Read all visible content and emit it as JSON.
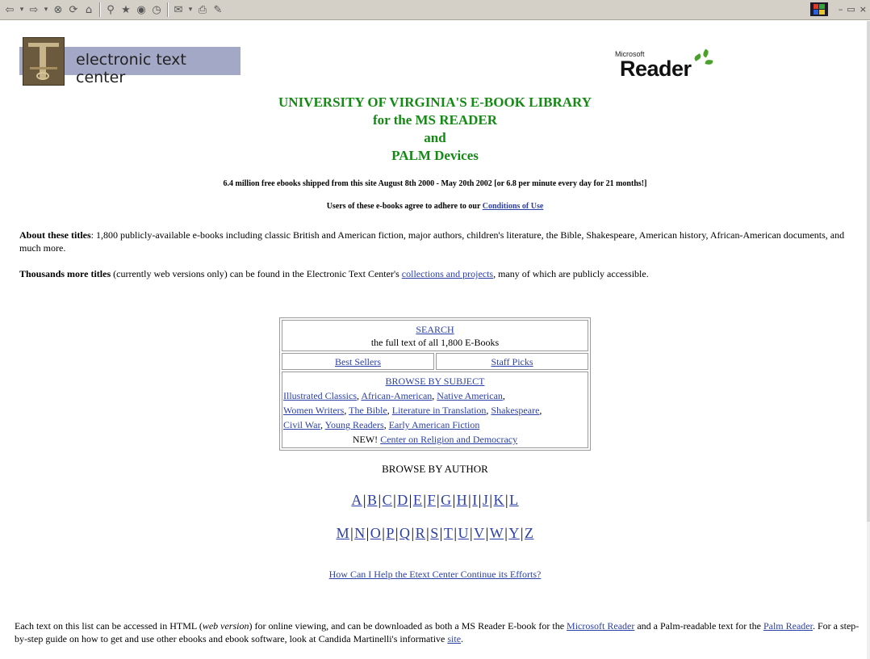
{
  "toolbar": {
    "icons": [
      "back-arrow-icon",
      "forward-arrow-icon",
      "stop-icon",
      "refresh-icon",
      "home-icon",
      "search-icon",
      "favorites-icon",
      "channels-icon",
      "history-icon",
      "mail-icon",
      "print-icon",
      "edit-icon"
    ],
    "window_controls": [
      "–",
      "Β",
      "×"
    ]
  },
  "header": {
    "etc_title": "electronic text center",
    "ms_small": "Microsoft",
    "ms_big": "Reader"
  },
  "titles": {
    "line1": "UNIVERSITY OF VIRGINIA'S E-BOOK LIBRARY",
    "line2": "for the MS READER",
    "line3": "and",
    "line4": "PALM Devices"
  },
  "stats": "6.4 million free ebooks shipped from this site August 8th 2000 - May 20th 2002 [or 6.8 per minute every day for 21 months!]",
  "terms": {
    "prefix": "Users of these e-books agree to adhere to our ",
    "link": "Conditions of Use"
  },
  "about": {
    "bold": "About these titles",
    "text": ": 1,800 publicly-available e-books including classic British and American fiction, major authors, children's literature, the Bible, Shakespeare, American history, African-American documents, and much more."
  },
  "more": {
    "bold": "Thousands more titles",
    "before": " (currently web versions only) can be found in the Electronic Text Center's ",
    "link": "collections and projects",
    "after": ", many of which are publicly accessible."
  },
  "box": {
    "search_link": "SEARCH",
    "search_sub": "the full text of all 1,800 E-Books",
    "best_sellers": "Best Sellers",
    "staff_picks": "Staff Picks",
    "browse_subject": "BROWSE BY SUBJECT",
    "subjects_line1": [
      "Illustrated Classics",
      "African-American",
      "Native American"
    ],
    "subjects_line2": [
      "Women Writers",
      "The Bible",
      "Literature in Translation",
      "Shakespeare"
    ],
    "subjects_line3": [
      "Civil War",
      "Young Readers",
      "Early American Fiction"
    ],
    "new_label": "NEW! ",
    "new_link": "Center on Religion and Democracy"
  },
  "authors": {
    "heading": "BROWSE BY AUTHOR",
    "row1": [
      "A",
      "B",
      "C",
      "D",
      "E",
      "F",
      "G",
      "H",
      "I",
      "J",
      "K",
      "L"
    ],
    "row2": [
      "M",
      "N",
      "O",
      "P",
      "Q",
      "R",
      "S",
      "T",
      "U",
      "V",
      "W",
      "Y",
      "Z"
    ]
  },
  "help_link": "How Can I Help the Etext Center Continue its Efforts?",
  "footer": {
    "t1": "Each text on this list can be accessed in HTML (",
    "em": "web version",
    "t2": ") for online viewing, and can be downloaded as both a MS Reader E-book for the ",
    "link1": "Microsoft Reader",
    "t3": " and a Palm-readable text for the ",
    "link2": "Palm Reader",
    "t4": ". For a step-by-step guide on how to get and use other ebooks and ebook software, look at Candida Martinelli's informative ",
    "link3": "site",
    "t5": "."
  }
}
